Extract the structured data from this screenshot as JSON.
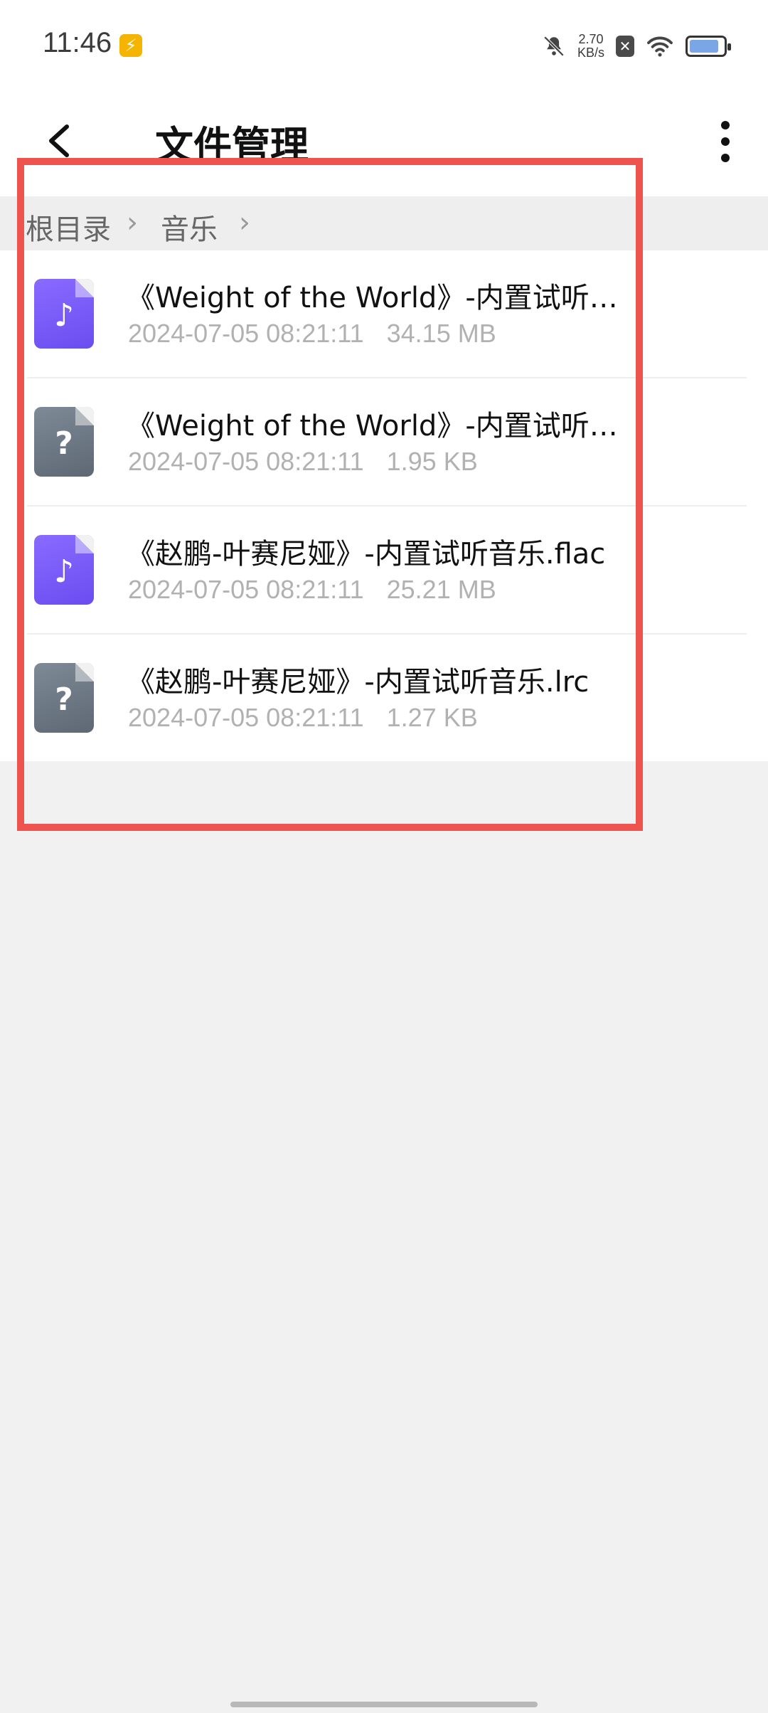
{
  "status_bar": {
    "time": "11:46",
    "speed_value": "2.70",
    "speed_unit": "KB/s",
    "icons": [
      "bolt-icon",
      "bell-muted-icon",
      "sim-x-icon",
      "wifi-icon",
      "battery-icon"
    ]
  },
  "header": {
    "title": "文件管理",
    "back_icon": "chevron-left-icon",
    "more_icon": "more-vertical-icon"
  },
  "breadcrumb": {
    "items": [
      "根目录",
      "音乐"
    ]
  },
  "files": [
    {
      "name": "《Weight of the World》-内置试听音乐.flac",
      "date": "2024-07-05 08:21:11",
      "size": "34.15 MB",
      "icon": "music-file-icon"
    },
    {
      "name": "《Weight of the World》-内置试听音乐.lrc",
      "date": "2024-07-05 08:21:11",
      "size": "1.95 KB",
      "icon": "unknown-file-icon"
    },
    {
      "name": "《赵鹏-叶赛尼娅》-内置试听音乐.flac",
      "date": "2024-07-05 08:21:11",
      "size": "25.21 MB",
      "icon": "music-file-icon"
    },
    {
      "name": "《赵鹏-叶赛尼娅》-内置试听音乐.lrc",
      "date": "2024-07-05 08:21:11",
      "size": "1.27 KB",
      "icon": "unknown-file-icon"
    }
  ],
  "colors": {
    "highlight": "#ef5350",
    "music_icon": "#7a5cf6",
    "unknown_icon": "#6b7681"
  }
}
